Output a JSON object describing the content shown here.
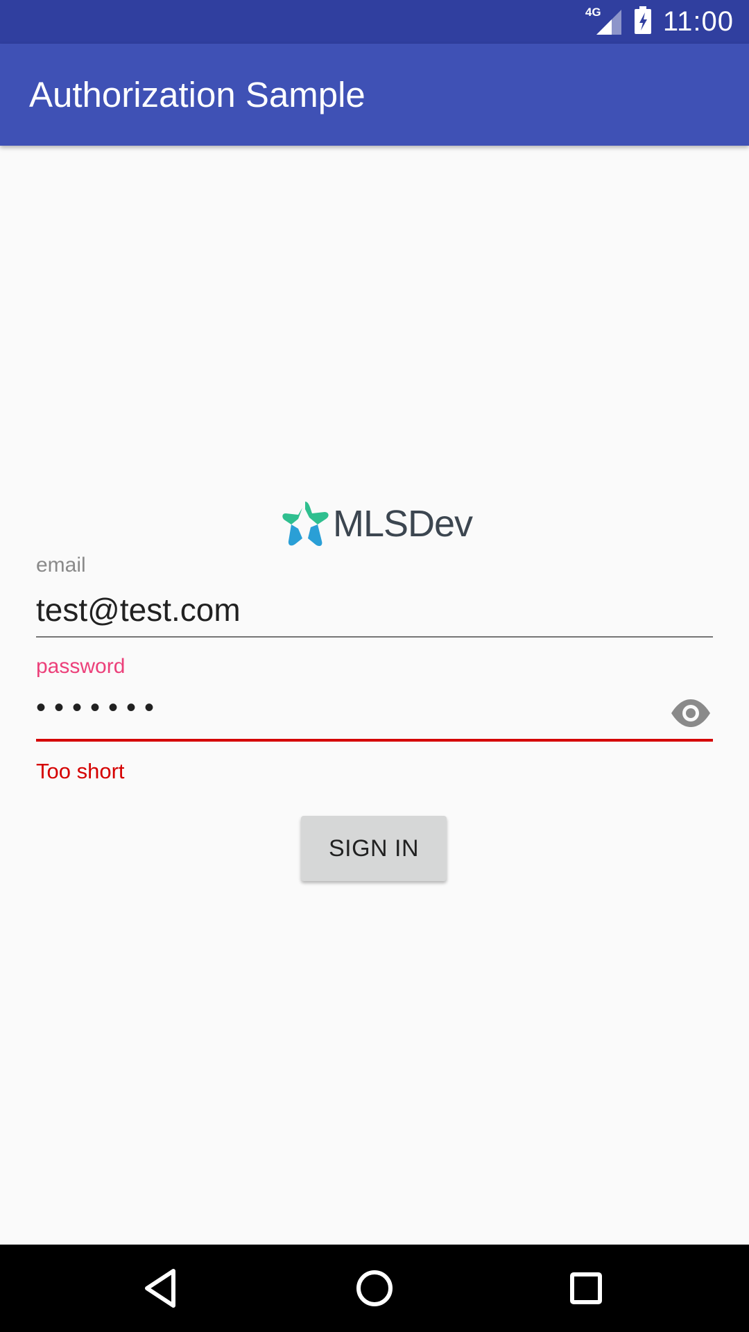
{
  "status_bar": {
    "network": "4G",
    "time": "11:00",
    "icons": [
      "signal-icon",
      "battery-icon"
    ]
  },
  "app_bar": {
    "title": "Authorization Sample"
  },
  "logo": {
    "text": "MLSDev",
    "colors": {
      "green": "#2fbf8f",
      "blue": "#2a9fd6"
    }
  },
  "form": {
    "email": {
      "label": "email",
      "value": "test@test.com"
    },
    "password": {
      "label": "password",
      "value": "•••••••",
      "error": "Too short",
      "toggle_icon": "eye-icon"
    },
    "sign_in_label": "SIGN IN"
  },
  "nav_bar": {
    "icons": [
      "back-icon",
      "home-icon",
      "recents-icon"
    ]
  },
  "colors": {
    "primary": "#3f51b5",
    "primary_dark": "#303f9f",
    "accent": "#ec407a",
    "error": "#d50000",
    "background": "#fafafa"
  }
}
